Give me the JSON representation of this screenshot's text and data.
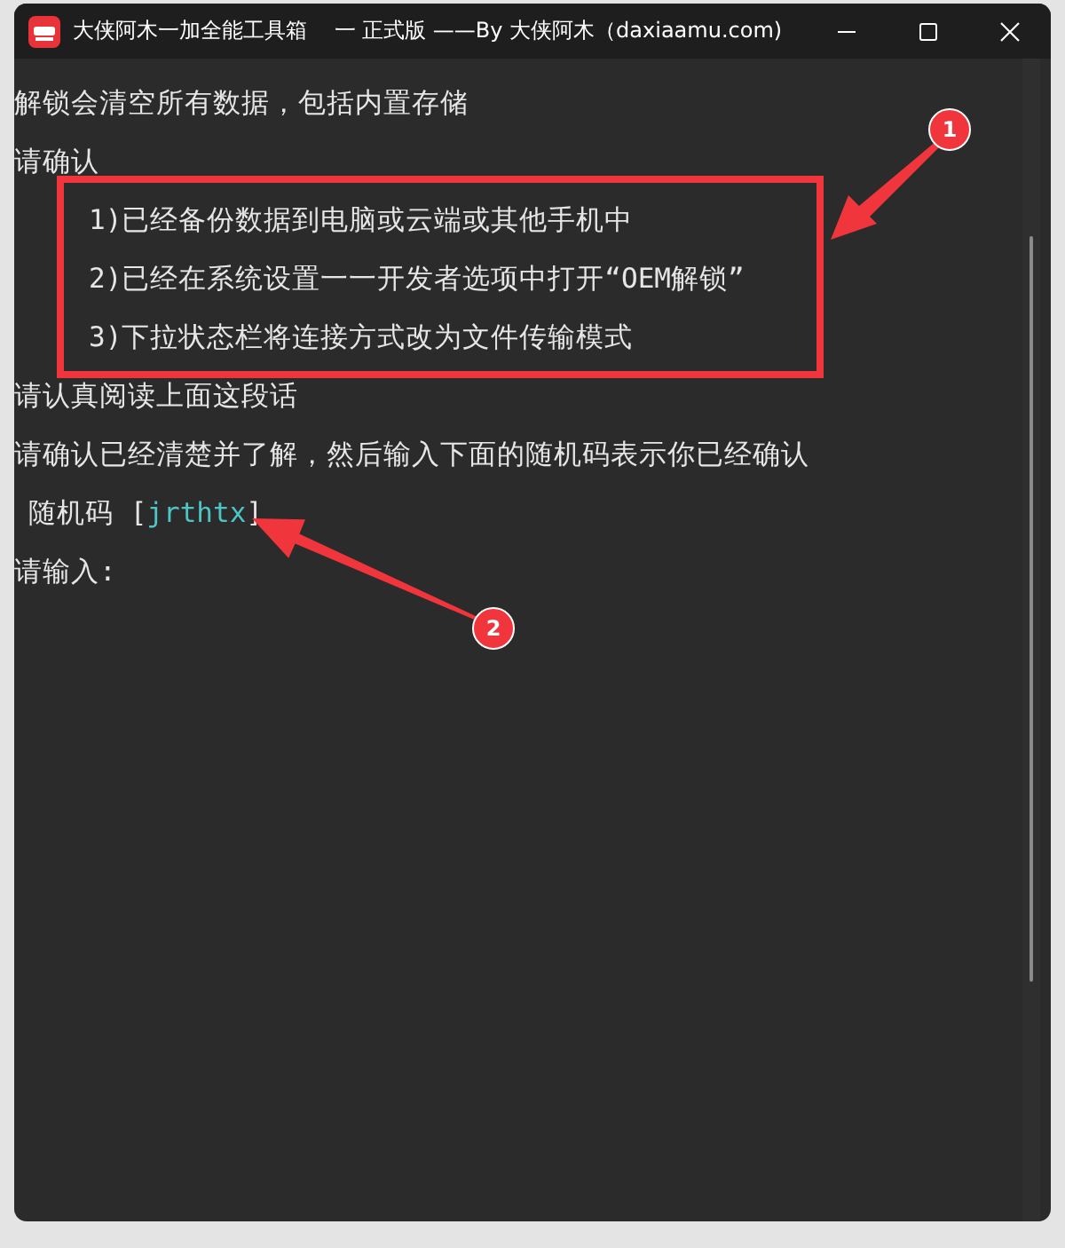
{
  "window": {
    "title": "大侠阿木一加全能工具箱    一 正式版 ——By 大侠阿木（daxiaamu.com)"
  },
  "console": {
    "lines": [
      {
        "kind": "plain",
        "text": "解锁会清空所有数据，包括内置存储"
      },
      {
        "kind": "plain",
        "text": "请确认"
      },
      {
        "kind": "item",
        "text": "1)已经备份数据到电脑或云端或其他手机中"
      },
      {
        "kind": "item",
        "text": "2)已经在系统设置一一开发者选项中打开“OEM解锁”"
      },
      {
        "kind": "item",
        "text": "3)下拉状态栏将连接方式改为文件传输模式"
      },
      {
        "kind": "plain",
        "text": "请认真阅读上面这段话"
      },
      {
        "kind": "plain",
        "text": "请确认已经清楚并了解，然后输入下面的随机码表示你已经确认"
      },
      {
        "kind": "code",
        "prefix": "随机码 [",
        "code": "jrthtx",
        "suffix": "]"
      },
      {
        "kind": "plain",
        "text": "请输入:"
      }
    ]
  },
  "annotations": [
    {
      "label": "1"
    },
    {
      "label": "2"
    }
  ]
}
